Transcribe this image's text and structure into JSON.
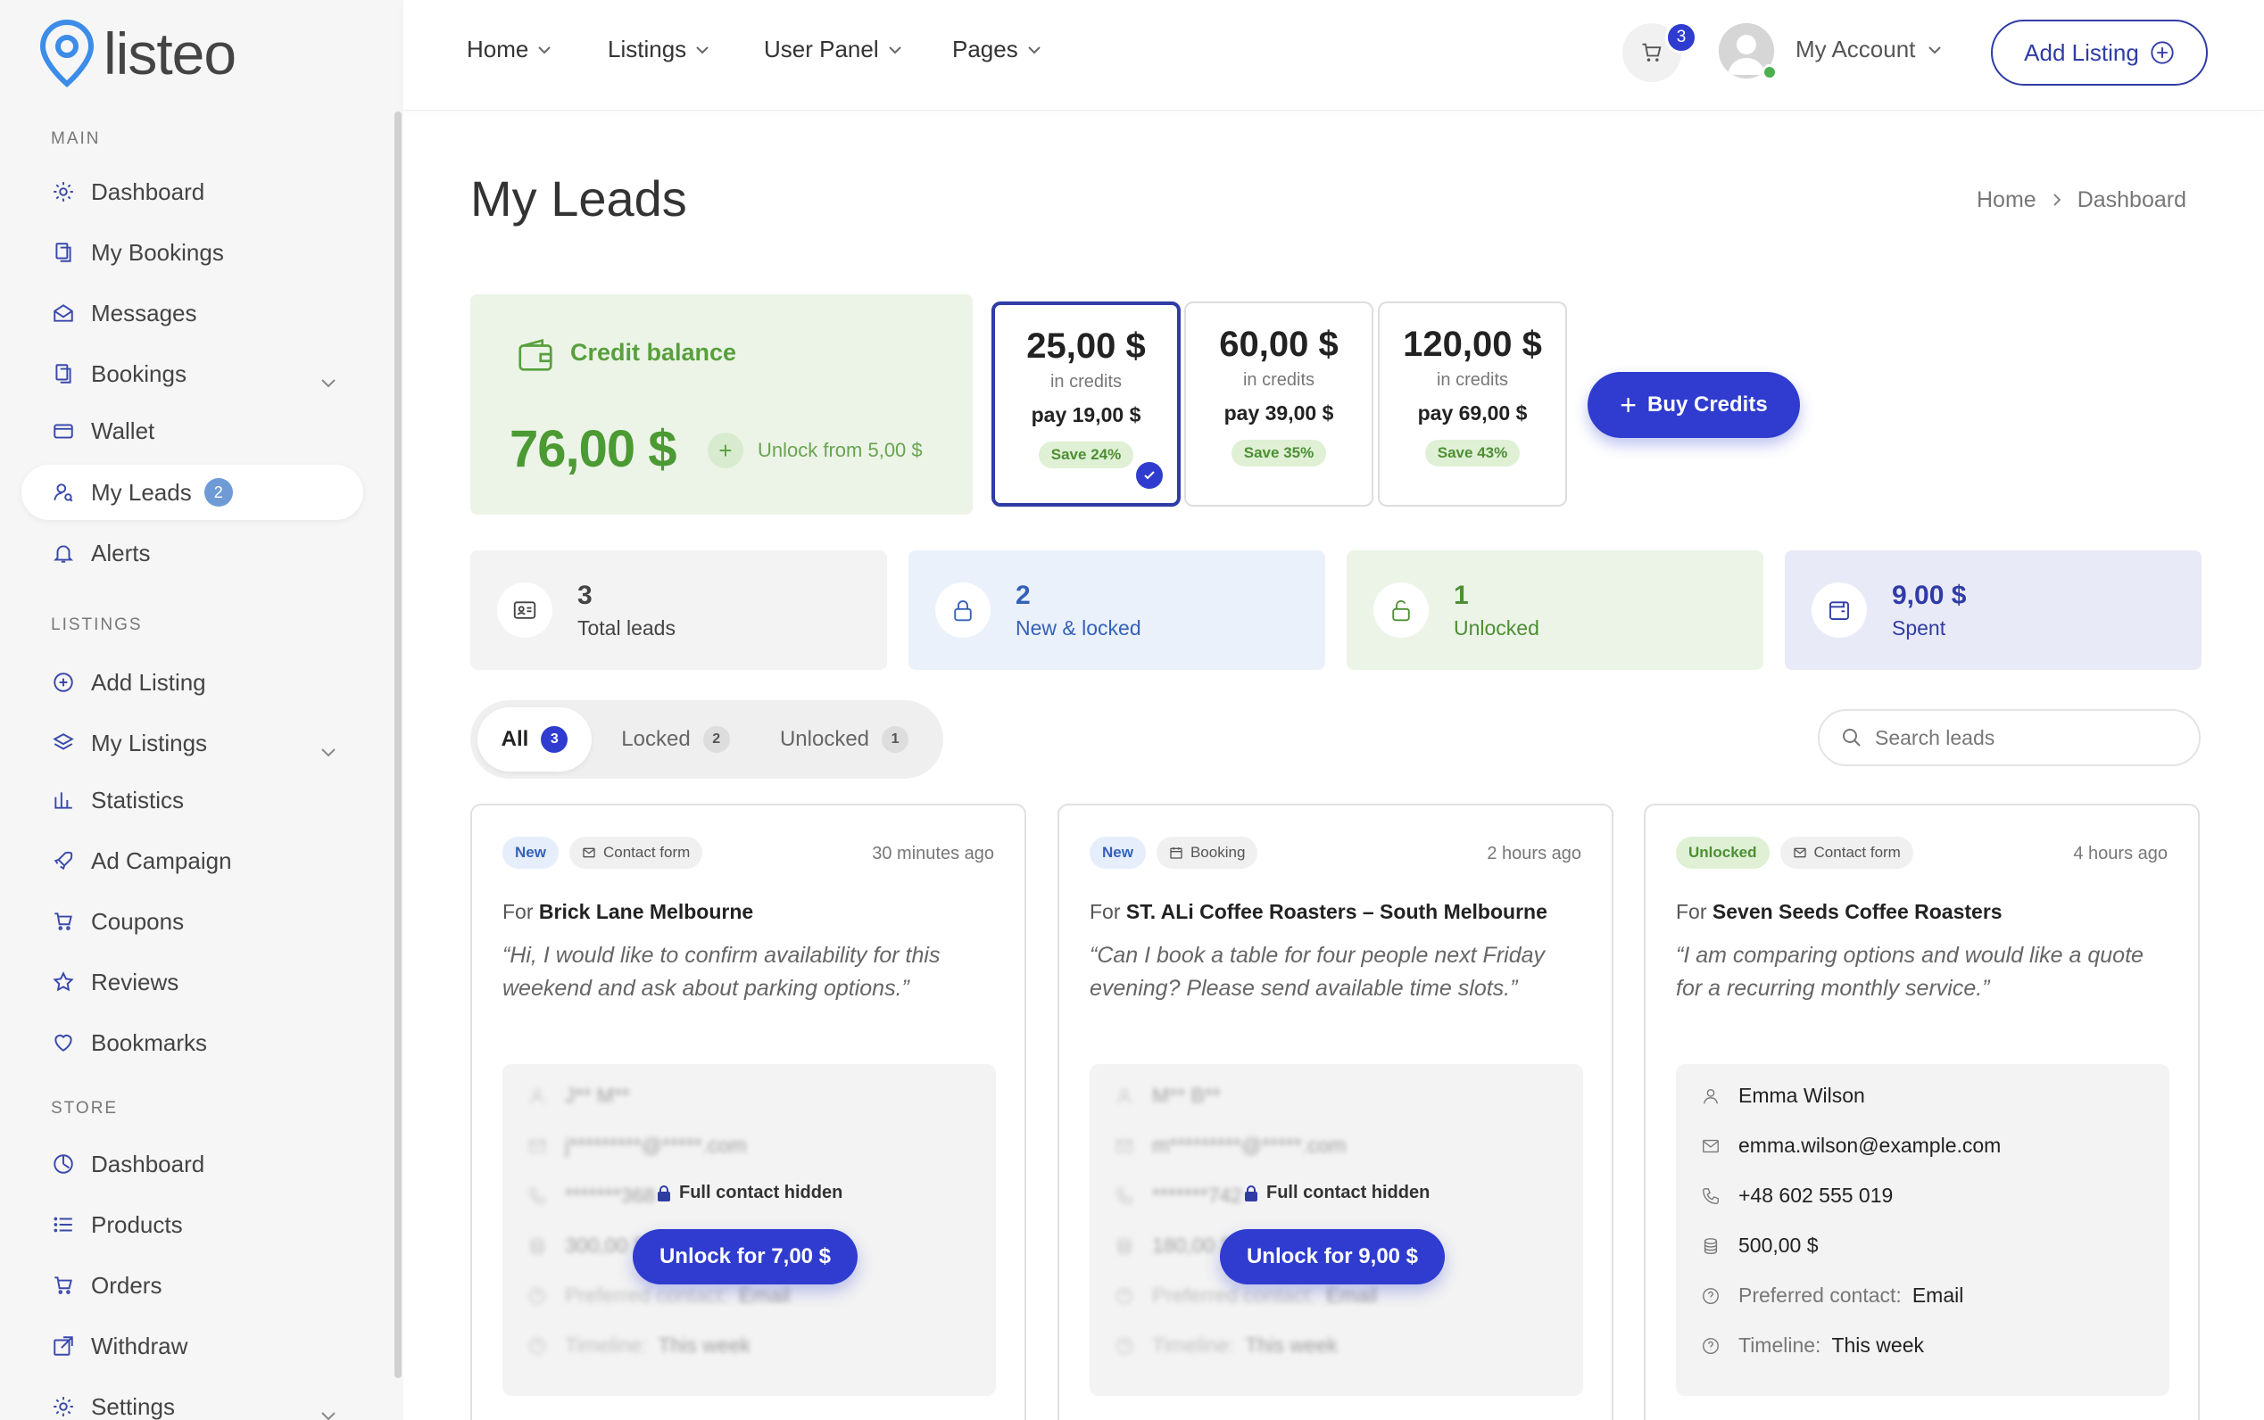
{
  "brand": {
    "name": "listeo"
  },
  "sidebar": {
    "sections": {
      "main": "MAIN",
      "listings": "LISTINGS",
      "store": "STORE"
    },
    "main_items": [
      {
        "label": "Dashboard",
        "icon": "gear-icon"
      },
      {
        "label": "My Bookings",
        "icon": "copy-icon"
      },
      {
        "label": "Messages",
        "icon": "envelope-open-icon"
      },
      {
        "label": "Bookings",
        "icon": "copy-icon"
      },
      {
        "label": "Wallet",
        "icon": "wallet-icon"
      },
      {
        "label": "My Leads",
        "icon": "user-search-icon",
        "badge": "2"
      },
      {
        "label": "Alerts",
        "icon": "bell-icon"
      }
    ],
    "listing_items": [
      {
        "label": "Add Listing",
        "icon": "plus-circle-icon"
      },
      {
        "label": "My Listings",
        "icon": "layers-icon"
      },
      {
        "label": "Statistics",
        "icon": "bar-chart-icon"
      },
      {
        "label": "Ad Campaign",
        "icon": "rocket-icon"
      },
      {
        "label": "Coupons",
        "icon": "cart-icon"
      },
      {
        "label": "Reviews",
        "icon": "star-icon"
      },
      {
        "label": "Bookmarks",
        "icon": "heart-icon"
      }
    ],
    "store_items": [
      {
        "label": "Dashboard",
        "icon": "dashboard-icon"
      },
      {
        "label": "Products",
        "icon": "list-icon"
      },
      {
        "label": "Orders",
        "icon": "cart-icon"
      },
      {
        "label": "Withdraw",
        "icon": "external-icon"
      },
      {
        "label": "Settings",
        "icon": "gear-icon"
      }
    ]
  },
  "header": {
    "nav": [
      "Home",
      "Listings",
      "User Panel",
      "Pages"
    ],
    "cart_count": "3",
    "account_label": "My Account",
    "add_listing": "Add Listing"
  },
  "page": {
    "title": "My Leads",
    "breadcrumb": [
      "Home",
      "Dashboard"
    ]
  },
  "credit": {
    "title": "Credit balance",
    "amount": "76,00 $",
    "unlock_from": "Unlock from 5,00 $"
  },
  "packages": [
    {
      "amount": "25,00 $",
      "label": "in credits",
      "pay": "pay 19,00 $",
      "save": "Save 24%",
      "selected": true
    },
    {
      "amount": "60,00 $",
      "label": "in credits",
      "pay": "pay 39,00 $",
      "save": "Save 35%",
      "selected": false
    },
    {
      "amount": "120,00 $",
      "label": "in credits",
      "pay": "pay 69,00 $",
      "save": "Save 43%",
      "selected": false
    }
  ],
  "buy_credits": "Buy Credits",
  "stats": [
    {
      "value": "3",
      "label": "Total leads",
      "bg": "#f3f3f3",
      "color": "#444"
    },
    {
      "value": "2",
      "label": "New & locked",
      "bg": "#ebf1fa",
      "color": "#3461b8"
    },
    {
      "value": "1",
      "label": "Unlocked",
      "bg": "#ecf4e7",
      "color": "#4d8f34"
    },
    {
      "value": "9,00 $",
      "label": "Spent",
      "bg": "#e9eaf8",
      "color": "#2f3ca6"
    }
  ],
  "tabs": [
    {
      "label": "All",
      "count": "3"
    },
    {
      "label": "Locked",
      "count": "2"
    },
    {
      "label": "Unlocked",
      "count": "1"
    }
  ],
  "search": {
    "placeholder": "Search leads"
  },
  "leads": [
    {
      "status": "New",
      "type": "Contact form",
      "time": "30 minutes ago",
      "for_prefix": "For",
      "listing": "Brick Lane Melbourne",
      "quote": "“Hi, I would like to confirm availability for this weekend and ask about parking options.”",
      "locked": true,
      "hidden_note": "Full contact hidden",
      "unlock": "Unlock for 7,00 $",
      "name": "J** M**",
      "email": "j*********@*****.com",
      "phone": "*******368",
      "budget": "300,00 $",
      "pref_label": "Preferred contact:",
      "pref": "Email",
      "timeline_label": "Timeline:",
      "timeline": "This week"
    },
    {
      "status": "New",
      "type": "Booking",
      "time": "2 hours ago",
      "for_prefix": "For",
      "listing": "ST. ALi Coffee Roasters – South Melbourne",
      "quote": "“Can I book a table for four people next Friday evening? Please send available time slots.”",
      "locked": true,
      "hidden_note": "Full contact hidden",
      "unlock": "Unlock for 9,00 $",
      "name": "M** B**",
      "email": "m*********@*****.com",
      "phone": "*******742",
      "budget": "180,00 $",
      "pref_label": "Preferred contact:",
      "pref": "Email",
      "timeline_label": "Timeline:",
      "timeline": "This week"
    },
    {
      "status": "Unlocked",
      "type": "Contact form",
      "time": "4 hours ago",
      "for_prefix": "For",
      "listing": "Seven Seeds Coffee Roasters",
      "quote": "“I am comparing options and would like a quote for a recurring monthly service.”",
      "locked": false,
      "name": "Emma Wilson",
      "email": "emma.wilson@example.com",
      "phone": "+48 602 555 019",
      "budget": "500,00 $",
      "pref_label": "Preferred contact:",
      "pref": "Email",
      "timeline_label": "Timeline:",
      "timeline": "This week"
    }
  ]
}
